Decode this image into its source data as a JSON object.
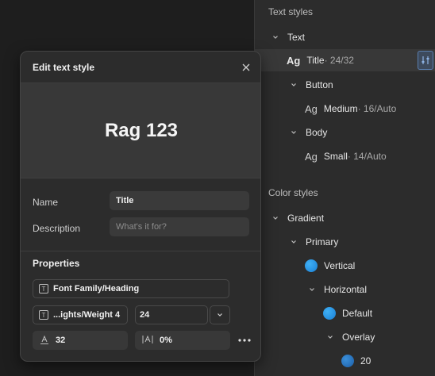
{
  "right_panel": {
    "text_styles_title": "Text styles",
    "text_group": "Text",
    "title_style": {
      "icon": "Ag",
      "name": "Title",
      "meta": " · 24/32"
    },
    "button_group": "Button",
    "medium_style": {
      "icon": "Ag",
      "name": "Medium",
      "meta": " · 16/Auto"
    },
    "body_group": "Body",
    "small_style": {
      "icon": "Ag",
      "name": "Small",
      "meta": " · 14/Auto"
    },
    "color_styles_title": "Color styles",
    "gradient_group": "Gradient",
    "primary_group": "Primary",
    "vertical_item": "Vertical",
    "horizontal_group": "Horizontal",
    "default_item": "Default",
    "overlay_group": "Overlay",
    "item_20": "20"
  },
  "dialog": {
    "title": "Edit text style",
    "preview_text": "Rag 123",
    "name_label": "Name",
    "name_value": "Title",
    "description_label": "Description",
    "description_placeholder": "What's it for?",
    "properties_title": "Properties",
    "font_family": "Font Family/Heading",
    "font_weight": "...ights/Weight 4",
    "font_size": "24",
    "line_height": "32",
    "letter_spacing": "0%"
  },
  "colors": {
    "accent": "#1a7fd4",
    "panel_bg": "#2c2c2c",
    "selected_row": "#383838"
  }
}
